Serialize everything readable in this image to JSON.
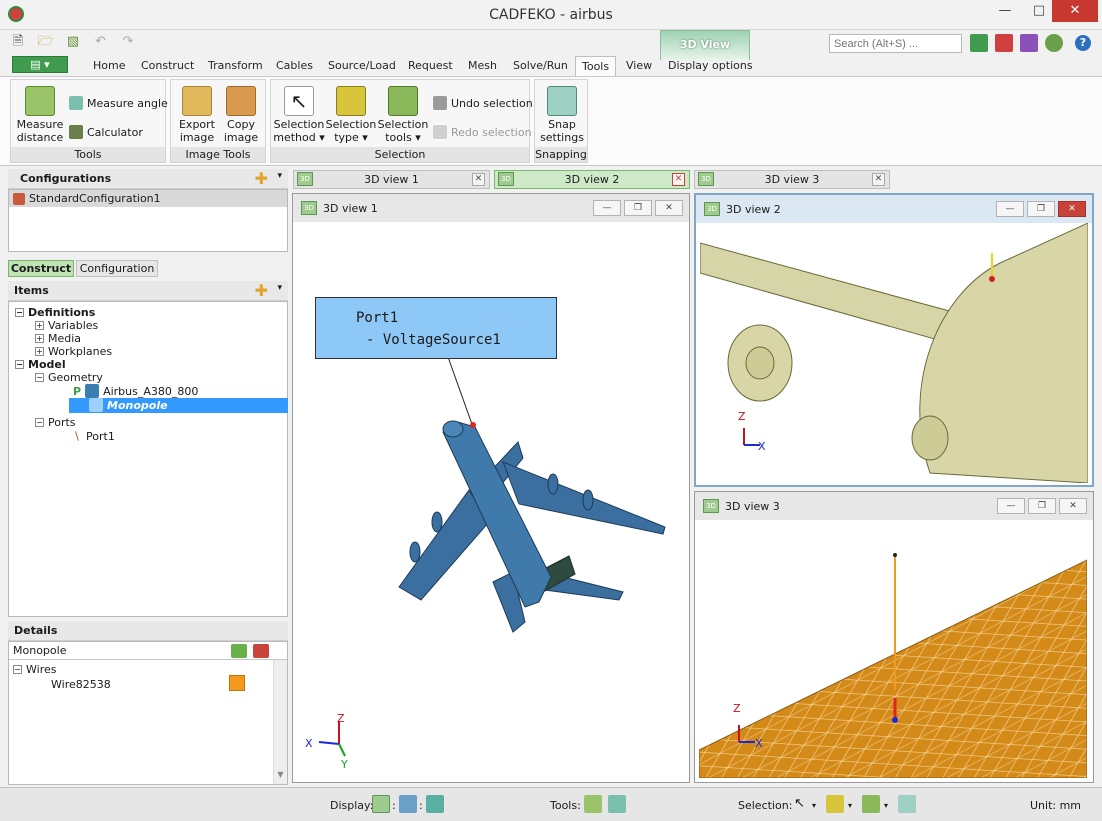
{
  "window": {
    "title": "CADFEKO - airbus"
  },
  "search": {
    "placeholder": "Search (Alt+S) ..."
  },
  "context_tab": "3D View",
  "ribbon_tabs": [
    "Home",
    "Construct",
    "Transform",
    "Cables",
    "Source/Load",
    "Request",
    "Mesh",
    "Solve/Run",
    "Tools",
    "View",
    "Display options"
  ],
  "groups": {
    "tools": {
      "label": "Tools",
      "measure_distance": "Measure\ndistance",
      "measure_angle": "Measure angle",
      "calculator": "Calculator"
    },
    "image": {
      "label": "Image Tools",
      "export": "Export\nimage",
      "copy": "Copy\nimage"
    },
    "selection": {
      "label": "Selection",
      "method": "Selection\nmethod",
      "type": "Selection\ntype",
      "tools": "Selection\ntools",
      "undo": "Undo selection",
      "redo": "Redo selection"
    },
    "snapping": {
      "label": "Snapping",
      "snap": "Snap\nsettings"
    }
  },
  "configurations": {
    "title": "Configurations",
    "items": [
      "StandardConfiguration1"
    ]
  },
  "panel_tabs": {
    "construct": "Construct",
    "configuration": "Configuration"
  },
  "items": {
    "title": "Items",
    "definitions": "Definitions",
    "variables": "Variables",
    "media": "Media",
    "workplanes": "Workplanes",
    "model": "Model",
    "geometry": "Geometry",
    "airbus": "Airbus_A380_800",
    "monopole": "Monopole",
    "ports": "Ports",
    "port1": "Port1"
  },
  "details": {
    "title": "Details",
    "header": "Monopole",
    "wires": "Wires",
    "wire": "Wire82538",
    "wire_color": "#f39a1e"
  },
  "doc_tabs": [
    "3D view 1",
    "3D view 2",
    "3D view 3"
  ],
  "views": {
    "v1": {
      "title": "3D view 1",
      "label_line1": "Port1",
      "label_line2": "- VoltageSource1"
    },
    "v2": {
      "title": "3D view 2"
    },
    "v3": {
      "title": "3D view 3"
    }
  },
  "axes": {
    "x": "X",
    "y": "Y",
    "z": "Z"
  },
  "status": {
    "display": "Display:",
    "tools": "Tools:",
    "selection": "Selection:",
    "unit": "Unit: mm"
  },
  "colors": {
    "accent_green": "#3f9c4f",
    "selection_blue": "#3399ff",
    "plane_blue": "#3a6f9f",
    "mesh_orange": "#d48a18"
  }
}
